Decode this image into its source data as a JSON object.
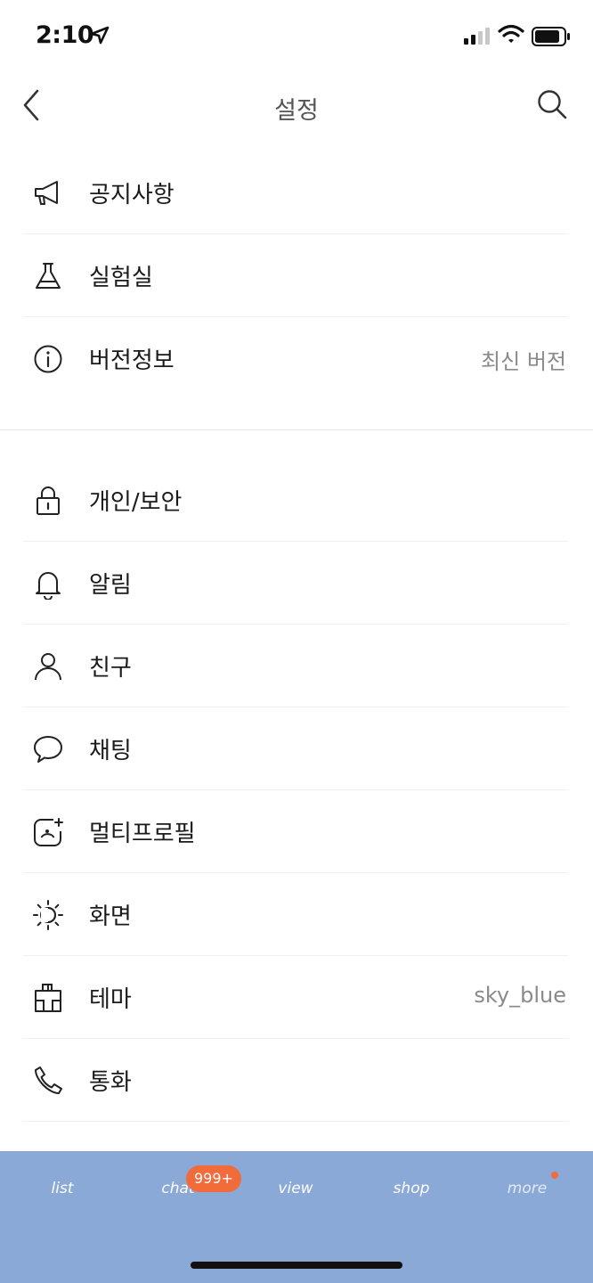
{
  "status_bar": {
    "time": "2:10",
    "icons": [
      "location-arrow-icon",
      "cellular-signal-icon",
      "wifi-icon",
      "battery-icon"
    ]
  },
  "header": {
    "title": "설정",
    "back_icon": "chevron-left-icon",
    "search_icon": "search-icon"
  },
  "groups": [
    {
      "items": [
        {
          "id": "notice",
          "label": "공지사항",
          "icon": "megaphone-icon",
          "value": ""
        },
        {
          "id": "lab",
          "label": "실험실",
          "icon": "flask-icon",
          "value": ""
        },
        {
          "id": "version",
          "label": "버전정보",
          "icon": "info-icon",
          "value": "최신 버전"
        }
      ]
    },
    {
      "items": [
        {
          "id": "privacy",
          "label": "개인/보안",
          "icon": "lock-icon",
          "value": ""
        },
        {
          "id": "alarm",
          "label": "알림",
          "icon": "bell-icon",
          "value": ""
        },
        {
          "id": "friends",
          "label": "친구",
          "icon": "person-icon",
          "value": ""
        },
        {
          "id": "chat",
          "label": "채팅",
          "icon": "speech-bubble-icon",
          "value": ""
        },
        {
          "id": "multiprofile",
          "label": "멀티프로필",
          "icon": "add-profile-icon",
          "value": ""
        },
        {
          "id": "screen",
          "label": "화면",
          "icon": "brightness-icon",
          "value": ""
        },
        {
          "id": "theme",
          "label": "테마",
          "icon": "paintbrush-icon",
          "value": "sky_blue"
        },
        {
          "id": "call",
          "label": "통화",
          "icon": "phone-icon",
          "value": ""
        }
      ]
    }
  ],
  "tab_bar": {
    "tabs": [
      {
        "label": "list"
      },
      {
        "label": "chat",
        "badge": "999+"
      },
      {
        "label": "view"
      },
      {
        "label": "shop"
      },
      {
        "label": "more",
        "has_dot": true
      }
    ],
    "background_color": "#8ba9d7",
    "badge_color": "#f26b3a"
  }
}
